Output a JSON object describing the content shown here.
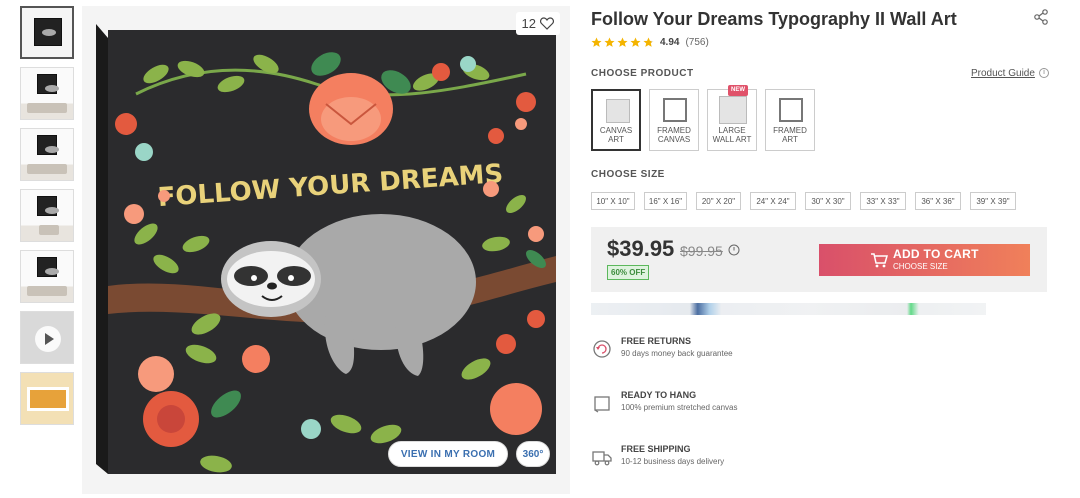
{
  "gallery": {
    "likes_count": "12",
    "artwork_text": "FOLLOW YOUR DREAMS",
    "view_room_label": "VIEW IN MY ROOM",
    "view_360_label": "360°"
  },
  "product": {
    "title": "Follow Your Dreams Typography II Wall Art",
    "rating_value": "4.94",
    "rating_count": "(756)",
    "stars": 4.94
  },
  "choose_product": {
    "label": "CHOOSE PRODUCT",
    "guide_link": "Product Guide",
    "info_icon": "i",
    "options": [
      {
        "line1": "CANVAS",
        "line2": "ART",
        "selected": true
      },
      {
        "line1": "FRAMED",
        "line2": "CANVAS",
        "selected": false
      },
      {
        "line1": "LARGE",
        "line2": "WALL ART",
        "selected": false,
        "badge": "NEW"
      },
      {
        "line1": "FRAMED",
        "line2": "ART",
        "selected": false
      }
    ]
  },
  "choose_size": {
    "label": "CHOOSE SIZE",
    "options": [
      "10\" X 10\"",
      "16\" X 16\"",
      "20\" X 20\"",
      "24\" X 24\"",
      "30\" X 30\"",
      "33\" X 33\"",
      "36\" X 36\"",
      "39\" X 39\""
    ]
  },
  "pricing": {
    "price": "$39.95",
    "old_price": "$99.95",
    "discount": "60% OFF",
    "cart_label": "ADD TO CART",
    "cart_sub": "CHOOSE SIZE"
  },
  "features": [
    {
      "title": "FREE RETURNS",
      "desc": "90 days money back guarantee"
    },
    {
      "title": "READY TO HANG",
      "desc": "100% premium stretched canvas"
    },
    {
      "title": "FREE SHIPPING",
      "desc": "10-12 business days delivery"
    }
  ],
  "colors": {
    "cart_start": "#d9506a",
    "cart_end": "#f0805a",
    "discount_green": "#5cb85c",
    "link_blue": "#3a6fb0",
    "canvas_bg": "#2b2b2d",
    "branch": "#7a4a32",
    "flower": "#f47f60",
    "leaf": "#8bb34a",
    "lettering": "#e9d27a"
  }
}
